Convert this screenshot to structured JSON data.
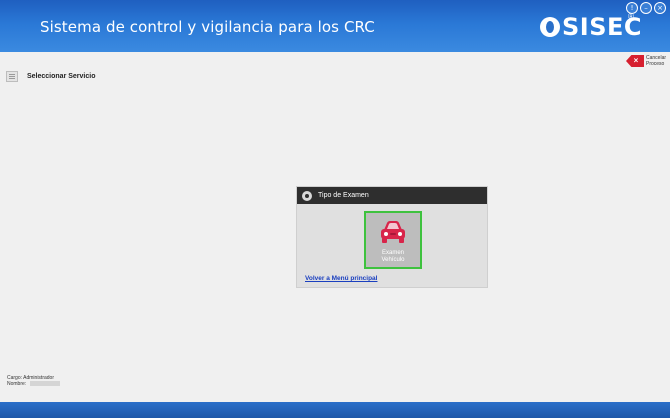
{
  "header": {
    "title": "Sistema de control y vigilancia para los CRC",
    "logo_text": "SISEC",
    "logo_reg": "®",
    "window_controls": {
      "help": "!",
      "minimize": "–",
      "close": "×"
    }
  },
  "toolbar": {
    "select_service_label": "Seleccionar Servicio",
    "cancel_line1": "Cancelar",
    "cancel_line2": "Proceso",
    "cancel_glyph": "×"
  },
  "exam_panel": {
    "title": "Tipo de Examen",
    "option_line1": "Examen",
    "option_line2": "Vehículo",
    "back_link": "Volver a Menú principal"
  },
  "user": {
    "cargo_label": "Cargo:",
    "cargo_value": "Administrador",
    "nombre_label": "Nombre:"
  },
  "colors": {
    "header_blue": "#2a78d6",
    "car_red": "#d8254a",
    "selection_green": "#3ec23e",
    "cancel_red": "#d61f2f"
  },
  "icons": [
    "list-icon",
    "cancel-icon",
    "gear-icon",
    "car-icon"
  ]
}
